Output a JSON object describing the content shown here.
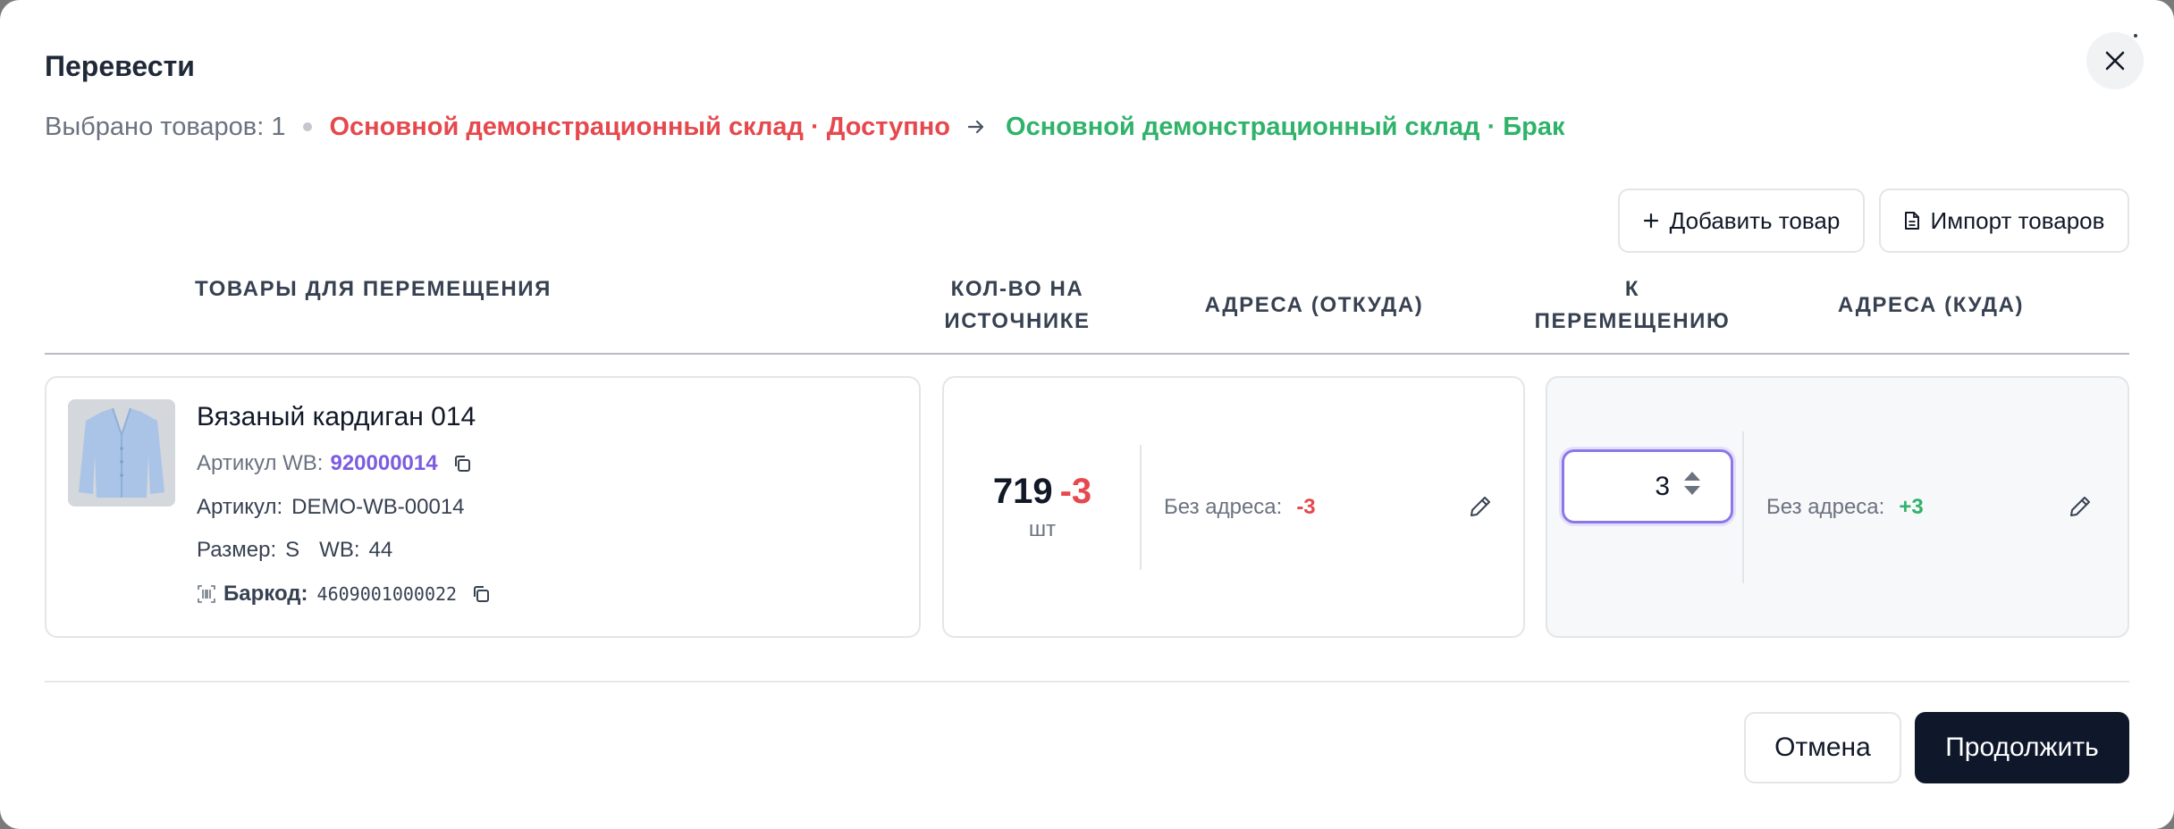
{
  "dialog": {
    "title": "Перевести",
    "selected_count": "Выбрано товаров: 1",
    "from_location": "Основной демонстрационный склад · Доступно",
    "to_location": "Основной демонстрационный склад · Брак"
  },
  "toolbar": {
    "add_label": "Добавить товар",
    "import_label": "Импорт товаров"
  },
  "table": {
    "columns": {
      "products": "Товары для перемещения",
      "source_qty_line1": "Кол-во на",
      "source_qty_line2": "источнике",
      "from_addresses": "Адреса (откуда)",
      "to_move_line1": "К",
      "to_move_line2": "перемещению",
      "to_addresses": "Адреса (куда)"
    },
    "row": {
      "name": "Вязаный кардиган 014",
      "wb_article_label": "Артикул WB:",
      "wb_article": "920000014",
      "article_label": "Артикул:",
      "article": "DEMO-WB-00014",
      "size_label": "Размер:",
      "size": "S",
      "wb_size_label": "WB:",
      "wb_size": "44",
      "barcode_label": "Баркод:",
      "barcode": "4609001000022",
      "source_qty": "719",
      "source_delta": "-3",
      "unit": "шт",
      "from_address_label": "Без адреса:",
      "from_address_delta": "-3",
      "move_qty": "3",
      "to_address_label": "Без адреса:",
      "to_address_delta": "+3"
    }
  },
  "footer": {
    "cancel_label": "Отмена",
    "continue_label": "Продолжить"
  },
  "colors": {
    "from_red": "#e5484d",
    "to_green": "#2fb36a",
    "accent_purple": "#7c5ce0",
    "primary_dark": "#0f172a"
  },
  "icons": [
    "close-icon",
    "arrow-right-icon",
    "plus-icon",
    "document-icon",
    "copy-icon",
    "barcode-icon",
    "pencil-icon",
    "stepper-arrows-icon"
  ]
}
